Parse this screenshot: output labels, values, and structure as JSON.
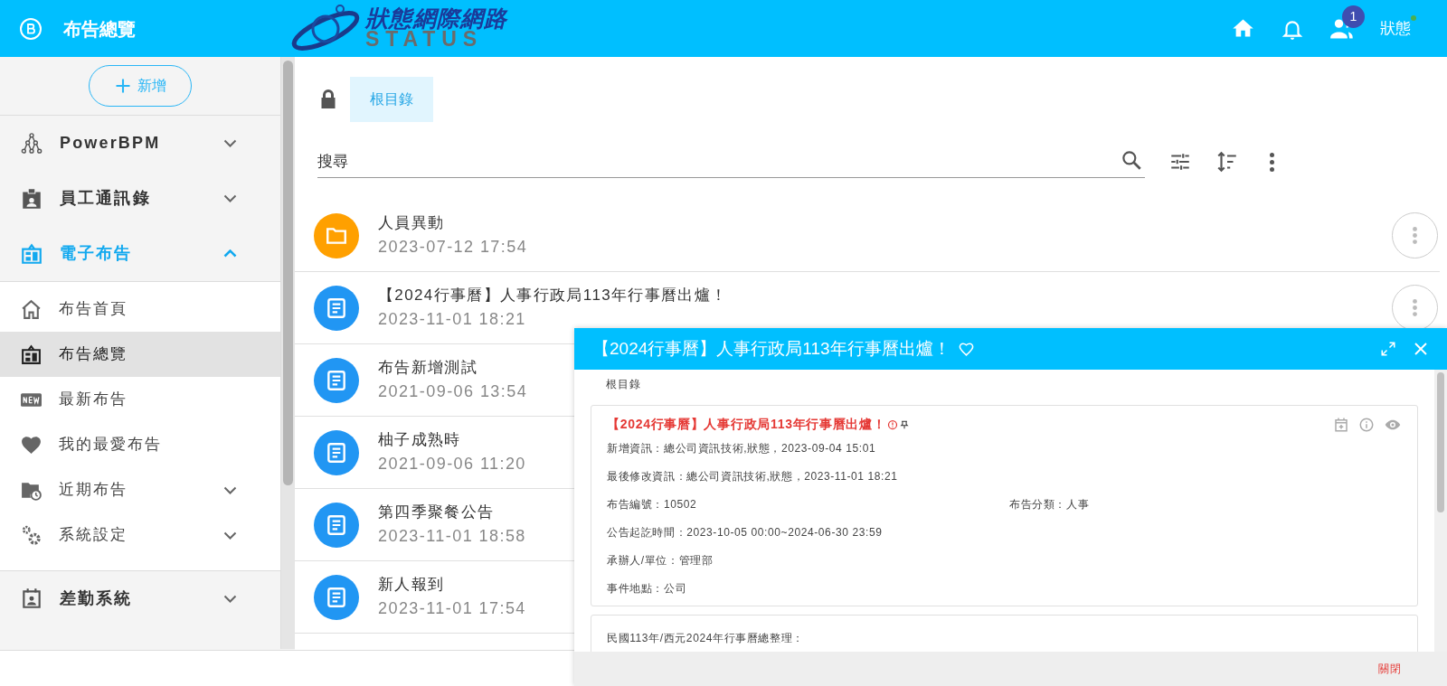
{
  "header": {
    "title": "布告總覽",
    "logo_text": "狀態網際網路",
    "logo_subtext": "STATUS",
    "notification_count": "1",
    "user": "狀態",
    "online": true
  },
  "sidebar": {
    "add_button": "新增",
    "sections": [
      {
        "label": "PowerBPM",
        "active": false,
        "expanded": false
      },
      {
        "label": "員工通訊錄",
        "active": false,
        "expanded": false
      },
      {
        "label": "電子布告",
        "active": true,
        "expanded": true,
        "children": [
          {
            "label": "布告首頁",
            "selected": false
          },
          {
            "label": "布告總覽",
            "selected": true
          },
          {
            "label": "最新布告",
            "selected": false
          },
          {
            "label": "我的最愛布告",
            "selected": false
          },
          {
            "label": "近期布告",
            "selected": false,
            "expanded": false
          },
          {
            "label": "系統設定",
            "selected": false,
            "expanded": false
          }
        ]
      },
      {
        "label": "差勤系統",
        "active": false,
        "expanded": false
      }
    ]
  },
  "content": {
    "root_tab": {
      "label": "根目錄",
      "selected": true
    },
    "search": {
      "placeholder": "搜尋"
    },
    "items": [
      {
        "kind": "folder",
        "title": "人員異動",
        "date": "2023-07-12 17:54",
        "menu": true
      },
      {
        "kind": "document",
        "title": "【2024行事曆】人事行政局113年行事曆出爐！",
        "date": "2023-11-01 18:21",
        "menu": true
      },
      {
        "kind": "document",
        "title": "布告新增測試",
        "date": "2021-09-06 13:54"
      },
      {
        "kind": "document",
        "title": "柚子成熟時",
        "date": "2021-09-06 11:20"
      },
      {
        "kind": "document",
        "title": "第四季聚餐公告",
        "date": "2023-11-01 18:58"
      },
      {
        "kind": "document",
        "title": "新人報到",
        "date": "2023-11-01 17:54"
      }
    ]
  },
  "dialog": {
    "title": "【2024行事曆】人事行政局113年行事曆出爐！",
    "favorite": false,
    "breadcrumb": "根目錄",
    "card": {
      "title": "【2024行事曆】人事行政局113年行事曆出爐！",
      "important": true,
      "pinned": true,
      "rows": [
        [
          "新增資訊：總公司資訊技術,狀態，2023-09-04 15:01"
        ],
        [
          "最後修改資訊：總公司資訊技術,狀態，2023-11-01 18:21"
        ],
        [
          "布告編號：10502",
          "布告分類：人事"
        ],
        [
          "公告起訖時間：2023-10-05 00:00~2024-06-30 23:59"
        ],
        [
          "承辦人/單位：管理部"
        ],
        [
          "事件地點：公司"
        ]
      ]
    },
    "next_card_text": "民國113年/西元2024年行事曆總整理：",
    "close_button": "關閉"
  }
}
